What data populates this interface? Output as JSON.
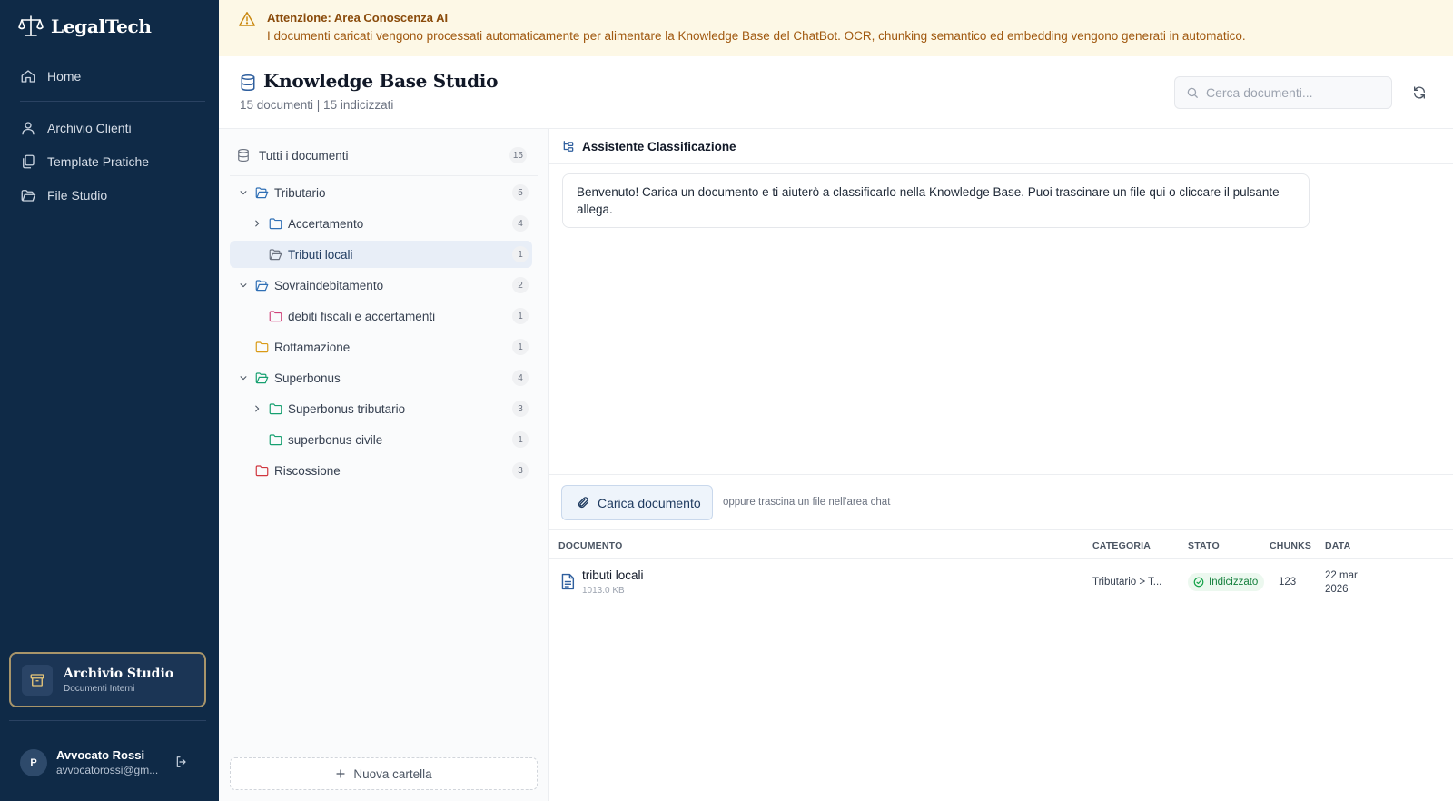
{
  "app": {
    "name": "LegalTech"
  },
  "sidebar": {
    "items": [
      {
        "label": "Home",
        "icon": "home-icon"
      },
      {
        "label": "Archivio Clienti",
        "icon": "user-icon"
      },
      {
        "label": "Template Pratiche",
        "icon": "copy-icon"
      },
      {
        "label": "File Studio",
        "icon": "folder-open-icon"
      }
    ],
    "studio_card": {
      "title": "Archivio Studio",
      "subtitle": "Documenti Interni",
      "icon": "archive-box-icon"
    },
    "user": {
      "initial": "P",
      "name": "Avvocato Rossi",
      "email": "avvocatorossi@gm..."
    }
  },
  "banner": {
    "title": "Attenzione: Area Conoscenza AI",
    "text": "I documenti caricati vengono processati automaticamente per alimentare la Knowledge Base del ChatBot. OCR, chunking semantico ed embedding vengono generati in automatico."
  },
  "header": {
    "title": "Knowledge Base Studio",
    "subtitle": "15 documenti | 15 indicizzati",
    "search_placeholder": "Cerca documenti..."
  },
  "tree": {
    "all": {
      "label": "Tutti i documenti",
      "count": "15"
    },
    "rows": [
      {
        "label": "Tributario",
        "count": "5",
        "level": 0,
        "chevron": "down",
        "color": "#2f6fb5"
      },
      {
        "label": "Accertamento",
        "count": "4",
        "level": 1,
        "chevron": "right",
        "color": "#2f6fb5"
      },
      {
        "label": "Tributi locali",
        "count": "1",
        "level": 1,
        "chevron": "",
        "color": "#6b7280",
        "selected": true
      },
      {
        "label": "Sovraindebitamento",
        "count": "2",
        "level": 0,
        "chevron": "down",
        "color": "#2f6fb5"
      },
      {
        "label": "debiti fiscali e accertamenti",
        "count": "1",
        "level": 1,
        "chevron": "",
        "color": "#d0437a"
      },
      {
        "label": "Rottamazione",
        "count": "1",
        "level": 0,
        "chevron": "",
        "color": "#d99a16"
      },
      {
        "label": "Superbonus",
        "count": "4",
        "level": 0,
        "chevron": "down",
        "color": "#16a070"
      },
      {
        "label": "Superbonus tributario",
        "count": "3",
        "level": 1,
        "chevron": "right",
        "color": "#16a070"
      },
      {
        "label": "superbonus civile",
        "count": "1",
        "level": 1,
        "chevron": "",
        "color": "#16a070"
      },
      {
        "label": "Riscossione",
        "count": "3",
        "level": 0,
        "chevron": "",
        "color": "#d0363f"
      }
    ],
    "new_folder": "Nuova cartella"
  },
  "chat": {
    "title": "Assistente Classificazione",
    "welcome": "Benvenuto! Carica un documento e ti aiuterò a classificarlo nella Knowledge Base. Puoi trascinare un file qui o cliccare il pulsante allega.",
    "upload_label": "Carica documento",
    "upload_hint": "oppure trascina un file nell'area chat"
  },
  "table": {
    "headers": {
      "document": "DOCUMENTO",
      "category": "CATEGORIA",
      "status": "STATO",
      "chunks": "CHUNKS",
      "date": "DATA"
    },
    "rows": [
      {
        "name": "tributi locali",
        "size": "1013.0 KB",
        "category": "Tributario > T...",
        "status": "Indicizzato",
        "chunks": "123",
        "date": "22 mar 2026"
      }
    ]
  },
  "colors": {
    "sidebar": "#0f2a47",
    "accent": "#1e3a5f",
    "banner_bg": "#fdf8e6",
    "status_ok": "#15803d"
  }
}
